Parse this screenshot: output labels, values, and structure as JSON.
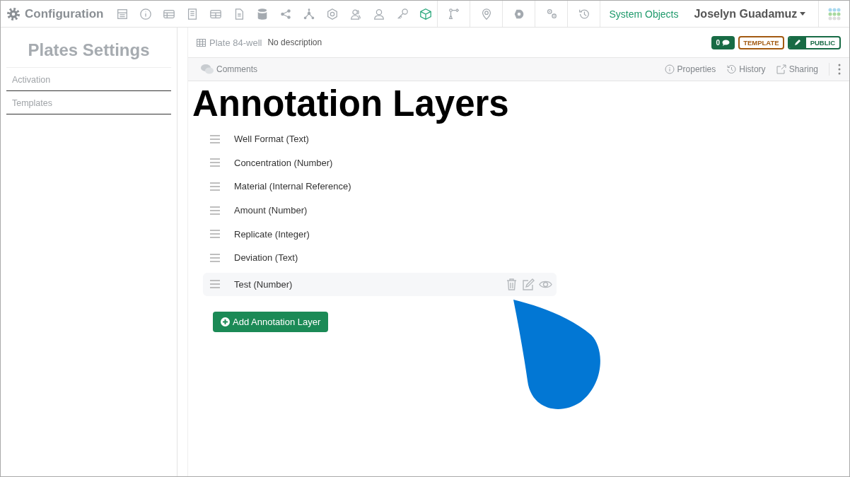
{
  "app": {
    "title": "Configuration"
  },
  "toolbar": [
    {
      "selected": false
    },
    {
      "selected": false
    },
    {
      "selected": false
    },
    {
      "selected": false
    },
    {
      "selected": false
    },
    {
      "selected": false
    },
    {
      "selected": false
    },
    {
      "selected": false
    },
    {
      "selected": false
    },
    {
      "selected": false
    },
    {
      "selected": false
    },
    {
      "selected": false
    },
    {
      "selected": false
    },
    {
      "selected": true
    },
    {
      "selected": false
    },
    {
      "selected": false
    },
    {
      "selected": false
    },
    {
      "selected": false
    },
    {
      "selected": false
    }
  ],
  "system_link": "System Objects",
  "user": "Joselyn Guadamuz",
  "sidebar": {
    "title": "Plates Settings",
    "items": [
      {
        "label": "Activation",
        "selected": false
      },
      {
        "label": "Templates",
        "selected": false
      }
    ]
  },
  "header": {
    "name": "Plate 84-well",
    "description": "No description",
    "comment_count": "0",
    "template_badge": "TEMPLATE",
    "public_badge": "PUBLIC"
  },
  "tabs": {
    "left": "Comments",
    "right": [
      "Properties",
      "History",
      "Sharing"
    ]
  },
  "heading": "Annotation Layers",
  "layers": [
    {
      "label": "Well Format (Text)",
      "selected": false
    },
    {
      "label": "Concentration (Number)",
      "selected": false
    },
    {
      "label": "Material (Internal Reference)",
      "selected": false
    },
    {
      "label": "Amount (Number)",
      "selected": false
    },
    {
      "label": "Replicate (Integer)",
      "selected": false
    },
    {
      "label": "Deviation (Text)",
      "selected": false
    },
    {
      "label": "Test (Number)",
      "selected": true
    }
  ],
  "add_button": "Add Annotation Layer"
}
